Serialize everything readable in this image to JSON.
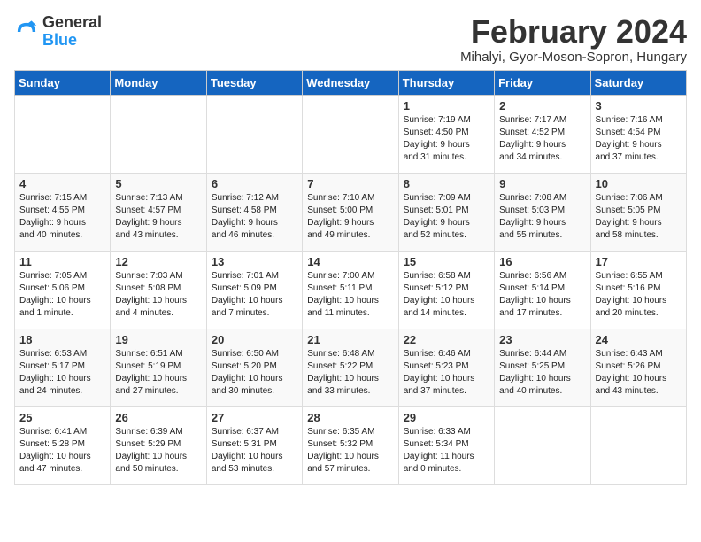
{
  "header": {
    "logo_line1": "General",
    "logo_line2": "Blue",
    "month_year": "February 2024",
    "location": "Mihalyi, Gyor-Moson-Sopron, Hungary"
  },
  "weekdays": [
    "Sunday",
    "Monday",
    "Tuesday",
    "Wednesday",
    "Thursday",
    "Friday",
    "Saturday"
  ],
  "weeks": [
    [
      {
        "day": "",
        "info": ""
      },
      {
        "day": "",
        "info": ""
      },
      {
        "day": "",
        "info": ""
      },
      {
        "day": "",
        "info": ""
      },
      {
        "day": "1",
        "info": "Sunrise: 7:19 AM\nSunset: 4:50 PM\nDaylight: 9 hours\nand 31 minutes."
      },
      {
        "day": "2",
        "info": "Sunrise: 7:17 AM\nSunset: 4:52 PM\nDaylight: 9 hours\nand 34 minutes."
      },
      {
        "day": "3",
        "info": "Sunrise: 7:16 AM\nSunset: 4:54 PM\nDaylight: 9 hours\nand 37 minutes."
      }
    ],
    [
      {
        "day": "4",
        "info": "Sunrise: 7:15 AM\nSunset: 4:55 PM\nDaylight: 9 hours\nand 40 minutes."
      },
      {
        "day": "5",
        "info": "Sunrise: 7:13 AM\nSunset: 4:57 PM\nDaylight: 9 hours\nand 43 minutes."
      },
      {
        "day": "6",
        "info": "Sunrise: 7:12 AM\nSunset: 4:58 PM\nDaylight: 9 hours\nand 46 minutes."
      },
      {
        "day": "7",
        "info": "Sunrise: 7:10 AM\nSunset: 5:00 PM\nDaylight: 9 hours\nand 49 minutes."
      },
      {
        "day": "8",
        "info": "Sunrise: 7:09 AM\nSunset: 5:01 PM\nDaylight: 9 hours\nand 52 minutes."
      },
      {
        "day": "9",
        "info": "Sunrise: 7:08 AM\nSunset: 5:03 PM\nDaylight: 9 hours\nand 55 minutes."
      },
      {
        "day": "10",
        "info": "Sunrise: 7:06 AM\nSunset: 5:05 PM\nDaylight: 9 hours\nand 58 minutes."
      }
    ],
    [
      {
        "day": "11",
        "info": "Sunrise: 7:05 AM\nSunset: 5:06 PM\nDaylight: 10 hours\nand 1 minute."
      },
      {
        "day": "12",
        "info": "Sunrise: 7:03 AM\nSunset: 5:08 PM\nDaylight: 10 hours\nand 4 minutes."
      },
      {
        "day": "13",
        "info": "Sunrise: 7:01 AM\nSunset: 5:09 PM\nDaylight: 10 hours\nand 7 minutes."
      },
      {
        "day": "14",
        "info": "Sunrise: 7:00 AM\nSunset: 5:11 PM\nDaylight: 10 hours\nand 11 minutes."
      },
      {
        "day": "15",
        "info": "Sunrise: 6:58 AM\nSunset: 5:12 PM\nDaylight: 10 hours\nand 14 minutes."
      },
      {
        "day": "16",
        "info": "Sunrise: 6:56 AM\nSunset: 5:14 PM\nDaylight: 10 hours\nand 17 minutes."
      },
      {
        "day": "17",
        "info": "Sunrise: 6:55 AM\nSunset: 5:16 PM\nDaylight: 10 hours\nand 20 minutes."
      }
    ],
    [
      {
        "day": "18",
        "info": "Sunrise: 6:53 AM\nSunset: 5:17 PM\nDaylight: 10 hours\nand 24 minutes."
      },
      {
        "day": "19",
        "info": "Sunrise: 6:51 AM\nSunset: 5:19 PM\nDaylight: 10 hours\nand 27 minutes."
      },
      {
        "day": "20",
        "info": "Sunrise: 6:50 AM\nSunset: 5:20 PM\nDaylight: 10 hours\nand 30 minutes."
      },
      {
        "day": "21",
        "info": "Sunrise: 6:48 AM\nSunset: 5:22 PM\nDaylight: 10 hours\nand 33 minutes."
      },
      {
        "day": "22",
        "info": "Sunrise: 6:46 AM\nSunset: 5:23 PM\nDaylight: 10 hours\nand 37 minutes."
      },
      {
        "day": "23",
        "info": "Sunrise: 6:44 AM\nSunset: 5:25 PM\nDaylight: 10 hours\nand 40 minutes."
      },
      {
        "day": "24",
        "info": "Sunrise: 6:43 AM\nSunset: 5:26 PM\nDaylight: 10 hours\nand 43 minutes."
      }
    ],
    [
      {
        "day": "25",
        "info": "Sunrise: 6:41 AM\nSunset: 5:28 PM\nDaylight: 10 hours\nand 47 minutes."
      },
      {
        "day": "26",
        "info": "Sunrise: 6:39 AM\nSunset: 5:29 PM\nDaylight: 10 hours\nand 50 minutes."
      },
      {
        "day": "27",
        "info": "Sunrise: 6:37 AM\nSunset: 5:31 PM\nDaylight: 10 hours\nand 53 minutes."
      },
      {
        "day": "28",
        "info": "Sunrise: 6:35 AM\nSunset: 5:32 PM\nDaylight: 10 hours\nand 57 minutes."
      },
      {
        "day": "29",
        "info": "Sunrise: 6:33 AM\nSunset: 5:34 PM\nDaylight: 11 hours\nand 0 minutes."
      },
      {
        "day": "",
        "info": ""
      },
      {
        "day": "",
        "info": ""
      }
    ]
  ]
}
